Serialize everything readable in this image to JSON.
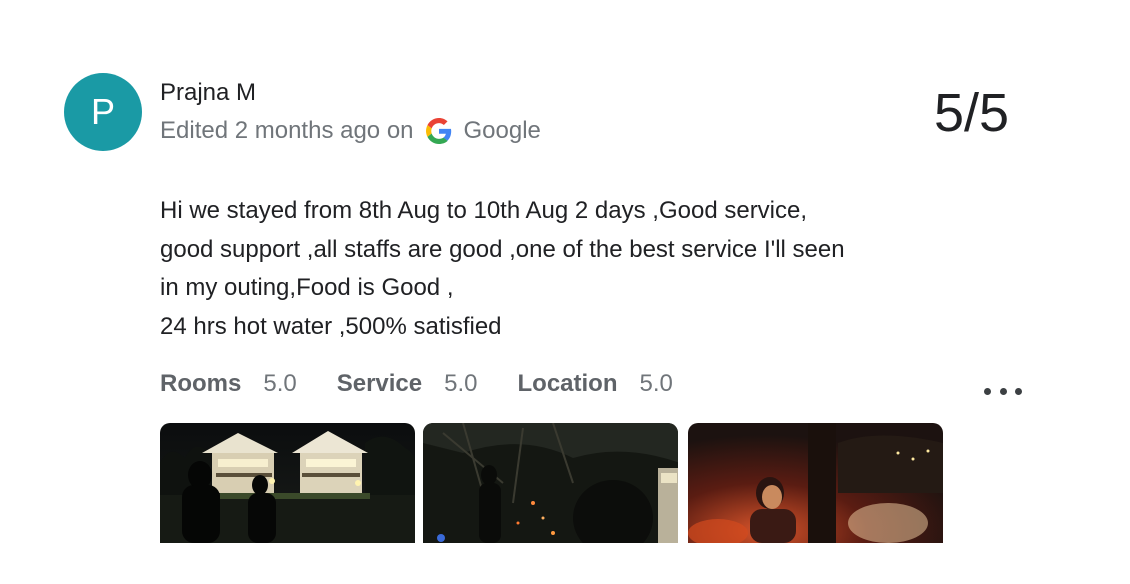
{
  "review": {
    "avatar_letter": "P",
    "author": "Prajna M",
    "meta_prefix": "Edited 2 months ago on",
    "source_icon": "google-g-icon",
    "source": "Google",
    "score": "5/5",
    "body_lines": [
      "Hi we stayed from 8th Aug to 10th Aug 2 days ,Good service,",
      "good support ,all staffs are good ,one of the best service I'll seen",
      "in my outing,Food is Good ,",
      "24 hrs hot water ,500% satisfied"
    ],
    "ratings": [
      {
        "label": "Rooms",
        "value": "5.0"
      },
      {
        "label": "Service",
        "value": "5.0"
      },
      {
        "label": "Location",
        "value": "5.0"
      }
    ],
    "more_icon": "more-horizontal-icon",
    "photos": [
      {
        "name": "villa-night-photo"
      },
      {
        "name": "bonfire-night-photo"
      },
      {
        "name": "campfire-people-photo"
      }
    ]
  },
  "colors": {
    "avatar_bg": "#1a9aa5",
    "text_primary": "#202124",
    "text_secondary": "#70757a",
    "rating_label": "#5f6368"
  }
}
